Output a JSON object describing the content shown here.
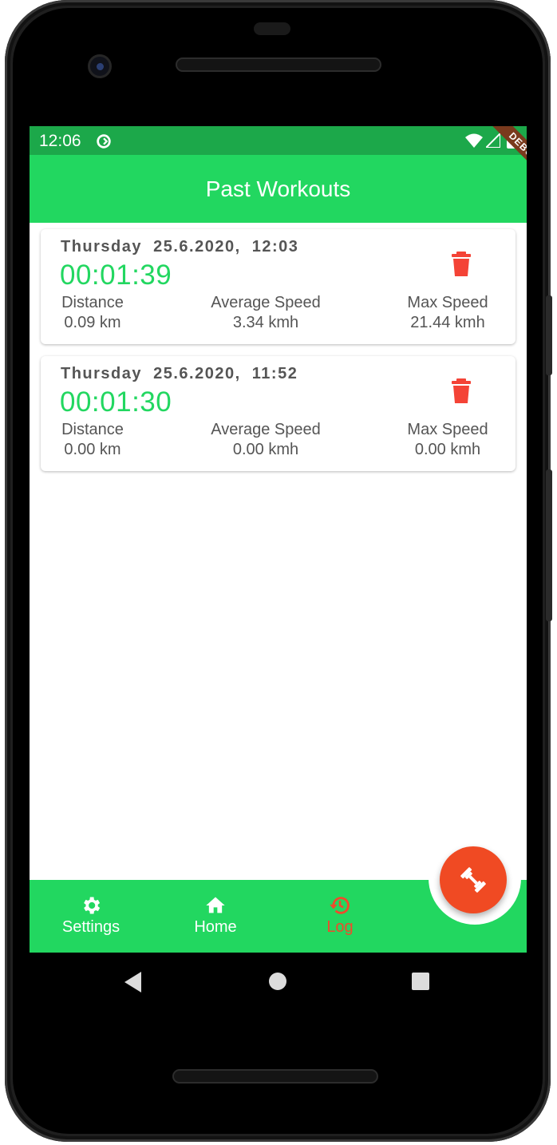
{
  "status_bar": {
    "time": "12:06",
    "sync_icon": "sync-circle-icon",
    "wifi_icon": "wifi-icon",
    "signal_icon": "cell-signal-icon",
    "battery_icon": "battery-icon",
    "debug_banner": "DEBUG"
  },
  "app_bar": {
    "title": "Past Workouts"
  },
  "workouts": [
    {
      "date": "Thursday  25.6.2020,  12:03",
      "duration": "00:01:39",
      "distance_label": "Distance",
      "distance": "0.09 km",
      "avg_speed_label": "Average Speed",
      "avg_speed": "3.34 kmh",
      "max_speed_label": "Max Speed",
      "max_speed": "21.44 kmh",
      "delete_icon": "trash-icon"
    },
    {
      "date": "Thursday  25.6.2020,  11:52",
      "duration": "00:01:30",
      "distance_label": "Distance",
      "distance": "0.00 km",
      "avg_speed_label": "Average Speed",
      "avg_speed": "0.00 kmh",
      "max_speed_label": "Max Speed",
      "max_speed": "0.00 kmh",
      "delete_icon": "trash-icon"
    }
  ],
  "bottom_nav": {
    "items": [
      {
        "label": "Settings",
        "icon": "gear-icon",
        "active": false
      },
      {
        "label": "Home",
        "icon": "home-icon",
        "active": false
      },
      {
        "label": "Log",
        "icon": "history-icon",
        "active": true
      }
    ],
    "fab_icon": "dumbbell-icon"
  },
  "system_nav": {
    "back_icon": "back-triangle-icon",
    "home_icon": "home-circle-icon",
    "recents_icon": "recents-square-icon"
  },
  "colors": {
    "primary_green": "#22d760",
    "status_green": "#1ca84a",
    "accent_red": "#f04a23",
    "delete_red": "#f44336",
    "text_gray": "#555555"
  }
}
